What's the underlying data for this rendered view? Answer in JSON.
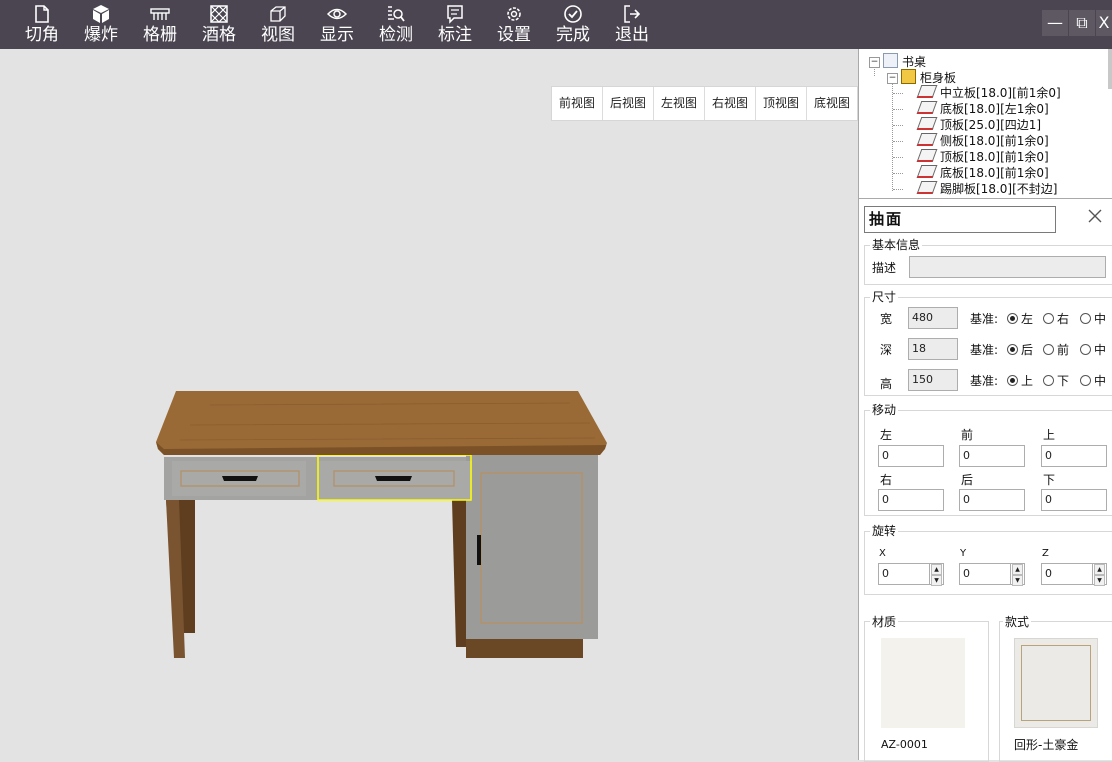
{
  "toolbar": {
    "items": [
      {
        "label": "切角",
        "icon": "file-icon"
      },
      {
        "label": "爆炸",
        "icon": "cube-icon"
      },
      {
        "label": "格栅",
        "icon": "grille-icon"
      },
      {
        "label": "酒格",
        "icon": "wine-rack-icon"
      },
      {
        "label": "视图",
        "icon": "view-cube-icon"
      },
      {
        "label": "显示",
        "icon": "eye-icon"
      },
      {
        "label": "检测",
        "icon": "inspect-icon"
      },
      {
        "label": "标注",
        "icon": "comment-icon"
      },
      {
        "label": "设置",
        "icon": "gear-icon"
      },
      {
        "label": "完成",
        "icon": "check-circle-icon"
      },
      {
        "label": "退出",
        "icon": "exit-icon"
      }
    ],
    "window": {
      "minimize": "—",
      "restore": "⧉",
      "close": "X"
    }
  },
  "views": [
    "前视图",
    "后视图",
    "左视图",
    "右视图",
    "顶视图",
    "底视图"
  ],
  "tree": {
    "root": "书桌",
    "group": "柜身板",
    "items": [
      "中立板[18.0][前1余0]",
      "底板[18.0][左1余0]",
      "顶板[25.0][四边1]",
      "侧板[18.0][前1余0]",
      "顶板[18.0][前1余0]",
      "底板[18.0][前1余0]",
      "踢脚板[18.0][不封边]"
    ]
  },
  "panel": {
    "title": "抽面",
    "basic": {
      "heading": "基本信息",
      "desc_label": "描述",
      "desc_value": ""
    },
    "size": {
      "heading": "尺寸",
      "datum_label": "基准:",
      "rows": [
        {
          "label": "宽",
          "value": "480",
          "options": [
            "左",
            "右",
            "中"
          ],
          "selected": 0
        },
        {
          "label": "深",
          "value": "18",
          "options": [
            "后",
            "前",
            "中"
          ],
          "selected": 0
        },
        {
          "label": "高",
          "value": "150",
          "options": [
            "上",
            "下",
            "中"
          ],
          "selected": 0
        }
      ]
    },
    "move": {
      "heading": "移动",
      "fields": [
        {
          "label": "左",
          "value": "0"
        },
        {
          "label": "前",
          "value": "0"
        },
        {
          "label": "上",
          "value": "0"
        },
        {
          "label": "右",
          "value": "0"
        },
        {
          "label": "后",
          "value": "0"
        },
        {
          "label": "下",
          "value": "0"
        }
      ]
    },
    "rotate": {
      "heading": "旋转",
      "fields": [
        {
          "label": "X",
          "value": "0"
        },
        {
          "label": "Y",
          "value": "0"
        },
        {
          "label": "Z",
          "value": "0"
        }
      ]
    },
    "material": {
      "heading": "材质",
      "code": "AZ-0001",
      "color": "#f3f2ed"
    },
    "style": {
      "heading": "款式",
      "name": "回形-土豪金",
      "color": "#eceae6"
    }
  },
  "colors": {
    "toolbar_bg": "#4a4550",
    "desk_top": "#9a6a36",
    "desk_panel": "#9a9a98",
    "selection": "#ffff00"
  }
}
